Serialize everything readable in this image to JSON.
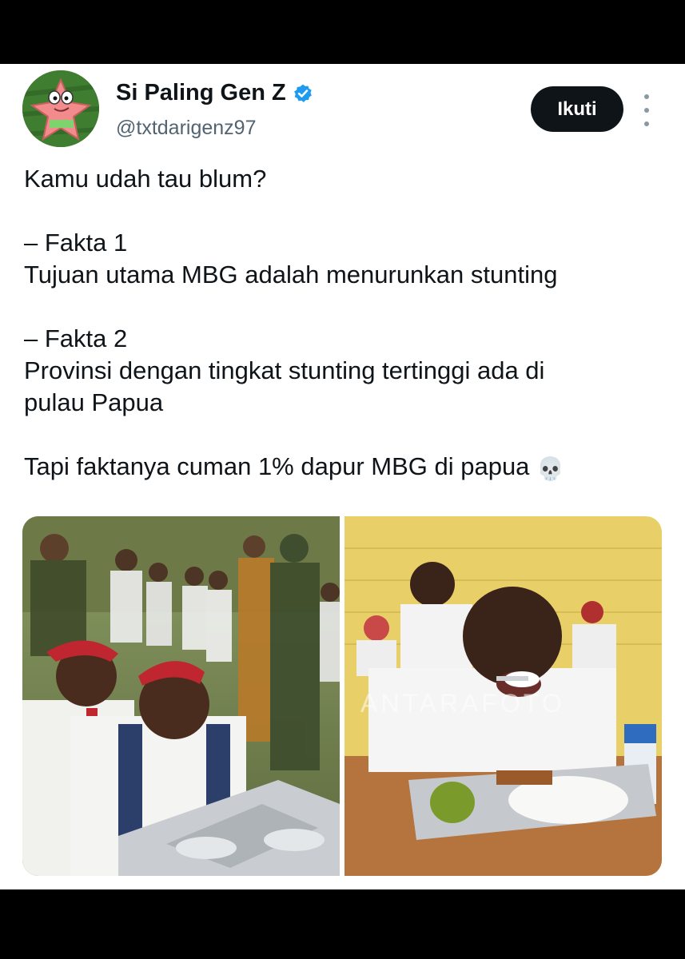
{
  "tweet": {
    "display_name": "Si Paling Gen Z",
    "handle": "@txtdarigenz97",
    "follow_label": "Ikuti",
    "text_lines": [
      "Kamu udah tau blum?",
      "– Fakta 1",
      "Tujuan utama MBG adalah menurunkan stunting",
      "– Fakta 2",
      "Provinsi dengan tingkat stunting tertinggi ada di",
      "pulau Papua",
      "Tapi faktanya cuman 1% dapur MBG di papua"
    ],
    "emoji": "💀",
    "photo2_watermark": "ANTARAFOTO"
  },
  "colors": {
    "text": "#0f1419",
    "secondary": "#536471",
    "verified": "#1d9bf0",
    "follow_bg": "#0f1419"
  },
  "icons": {
    "verified": "verified-badge-icon",
    "more": "more-dots-icon"
  }
}
